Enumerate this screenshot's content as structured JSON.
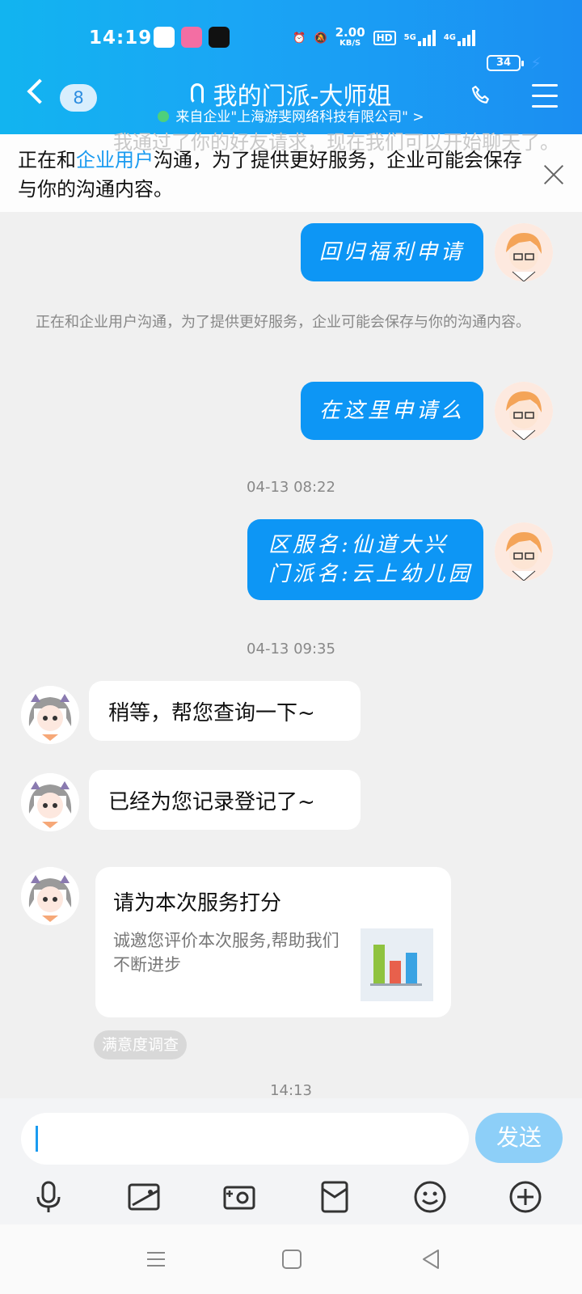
{
  "status": {
    "time": "14:19",
    "speed_value": "2.00",
    "speed_unit": "KB/S",
    "hd": "HD",
    "net5g": "5G",
    "net4g": "4G",
    "battery": "34"
  },
  "header": {
    "badge": "8",
    "title": "我的门派-大师姐",
    "subtitle": "来自企业\"上海游斐网络科技有限公司\" >"
  },
  "notice": {
    "prefix": "正在和",
    "highlight": "企业用户",
    "suffix": "沟通，为了提供更好服务，企业可能会保存与你的沟通内容。",
    "ghost": "我通过了你的好友请求，现在我们可以开始聊天了。"
  },
  "messages": {
    "m1": "回归福利申请",
    "system": "正在和企业用户沟通，为了提供更好服务，企业可能会保存与你的沟通内容。",
    "m2": "在这里申请么",
    "ts1": "04-13 08:22",
    "m3_line1": "区服名:仙道大兴",
    "m3_line2": "门派名:云上幼儿园",
    "ts2": "04-13 09:35",
    "m4": "稍等，帮您查询一下~",
    "m5": "已经为您记录登记了~",
    "card_title": "请为本次服务打分",
    "card_desc": "诚邀您评价本次服务,帮助我们不断进步",
    "tag": "满意度调查",
    "ts3": "14:13"
  },
  "input": {
    "send_label": "发送"
  },
  "icons": [
    "mic-icon",
    "image-icon",
    "camera-icon",
    "red-packet-icon",
    "emoji-icon",
    "plus-icon"
  ],
  "colors": {
    "header_start": "#12b4f0",
    "header_end": "#1b8ef2",
    "bubble_sent": "#0d96f5",
    "send_button": "#8dcff8",
    "highlight": "#1a9bf0"
  }
}
